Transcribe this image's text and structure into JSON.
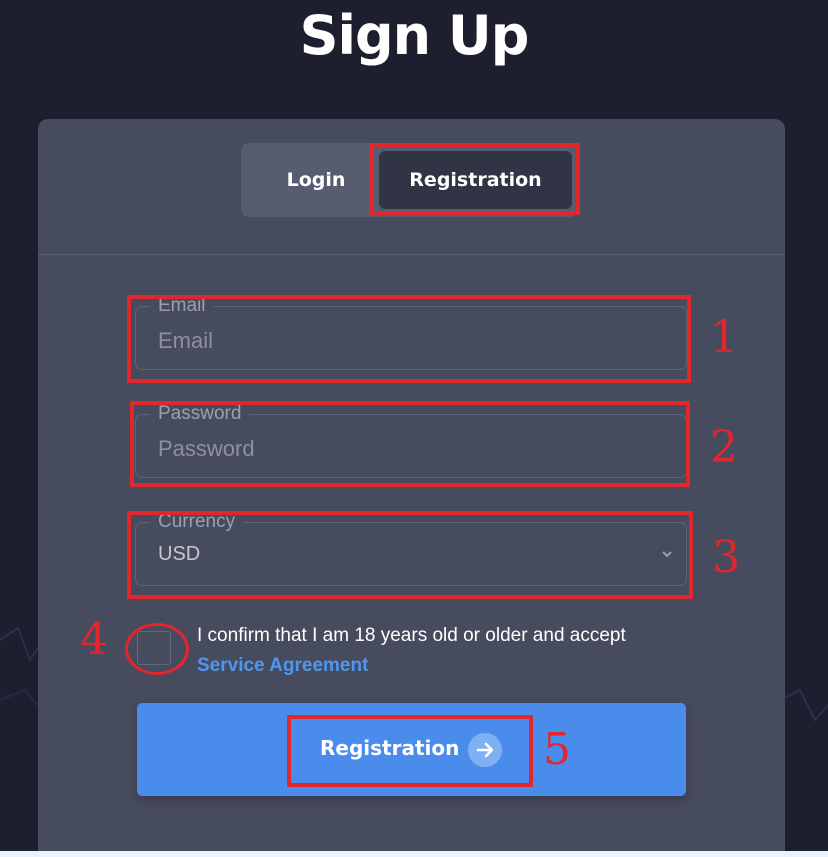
{
  "page": {
    "title": "Sign Up"
  },
  "tabs": [
    {
      "label": "Login",
      "active": false
    },
    {
      "label": "Registration",
      "active": true
    }
  ],
  "form": {
    "email": {
      "legend": "Email",
      "placeholder": "Email",
      "value": ""
    },
    "password": {
      "legend": "Password",
      "placeholder": "Password",
      "value": ""
    },
    "currency": {
      "legend": "Currency",
      "selected": "USD"
    },
    "agreement": {
      "checked": false,
      "text": "I confirm that I am 18 years old or older and accept",
      "link": "Service Agreement"
    },
    "submit": {
      "label": "Registration"
    }
  },
  "annotations": [
    "1",
    "2",
    "3",
    "4",
    "5"
  ],
  "colors": {
    "background": "#1d1e2e",
    "card": "#474b5e",
    "accent": "#4a8cec",
    "link": "#4e97f0",
    "annotation": "#e3262d"
  },
  "icons": {
    "currency_dropdown": "chevron-down-icon",
    "submit_arrow": "arrow-right-icon"
  }
}
